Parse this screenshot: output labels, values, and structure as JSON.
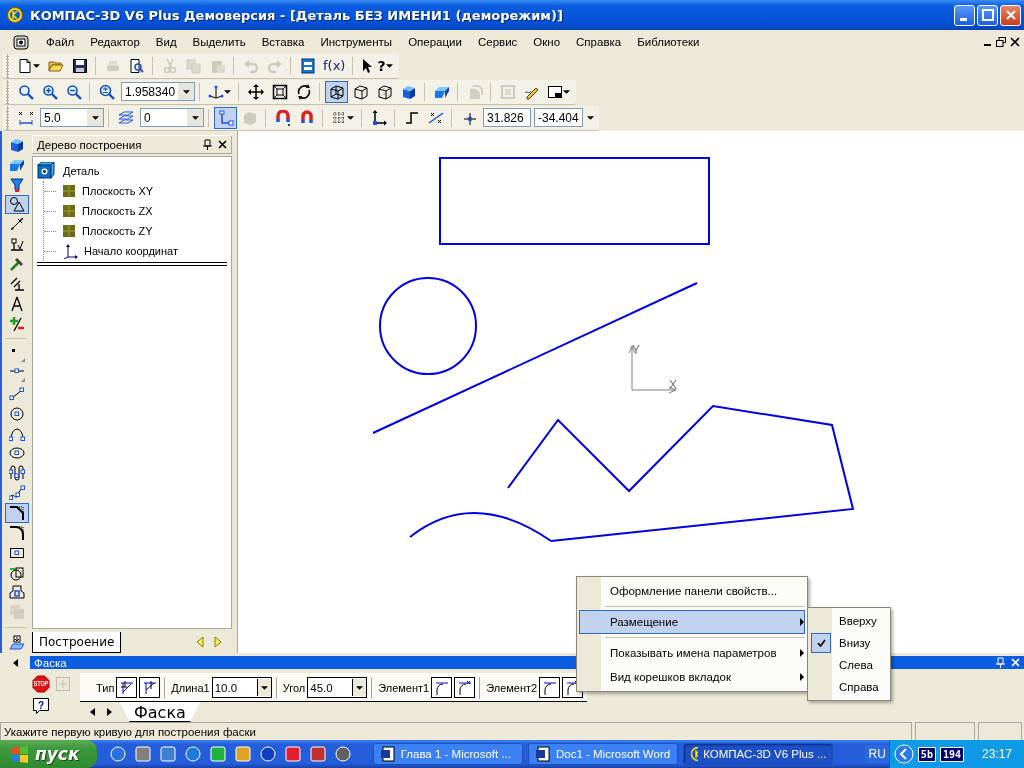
{
  "window": {
    "title": "КОМПАС-3D V6 Plus Демоверсия - [Деталь БЕЗ ИМЕНИ1 (деморежим)]"
  },
  "menu_bar": {
    "items": [
      "Файл",
      "Редактор",
      "Вид",
      "Выделить",
      "Вставка",
      "Инструменты",
      "Операции",
      "Сервис",
      "Окно",
      "Справка",
      "Библиотеки"
    ]
  },
  "toolbars": [
    {
      "items": [
        {
          "kind": "button",
          "selected": false,
          "disabled": false,
          "menu": true
        },
        {
          "kind": "button",
          "selected": false,
          "disabled": false
        },
        {
          "kind": "button",
          "selected": false,
          "disabled": false
        },
        {
          "kind": "separator"
        },
        {
          "kind": "button",
          "selected": false,
          "disabled": true
        },
        {
          "kind": "button",
          "selected": false,
          "disabled": false
        },
        {
          "kind": "separator"
        },
        {
          "kind": "button",
          "selected": false,
          "disabled": true
        },
        {
          "kind": "button",
          "selected": false,
          "disabled": true
        },
        {
          "kind": "button",
          "selected": false,
          "disabled": true
        },
        {
          "kind": "separator"
        },
        {
          "kind": "button",
          "selected": false,
          "disabled": true
        },
        {
          "kind": "button",
          "selected": false,
          "disabled": true
        },
        {
          "kind": "separator"
        },
        {
          "kind": "button",
          "selected": false,
          "disabled": false
        },
        {
          "kind": "button",
          "selected": false,
          "disabled": false,
          "label": "f(x)"
        },
        {
          "kind": "separator"
        },
        {
          "kind": "button",
          "selected": false,
          "disabled": false,
          "label": "?",
          "menu": true
        }
      ]
    },
    {
      "items": [
        {
          "kind": "button",
          "selected": false,
          "disabled": false
        },
        {
          "kind": "button",
          "selected": false,
          "disabled": false
        },
        {
          "kind": "button",
          "selected": false,
          "disabled": false
        },
        {
          "kind": "separator"
        },
        {
          "kind": "button",
          "selected": false,
          "disabled": false
        },
        {
          "kind": "combo",
          "value": "1.958340"
        },
        {
          "kind": "separator"
        },
        {
          "kind": "button",
          "selected": false,
          "disabled": false,
          "menu": true
        },
        {
          "kind": "separator"
        },
        {
          "kind": "button",
          "selected": false,
          "disabled": false
        },
        {
          "kind": "button",
          "selected": false,
          "disabled": false
        },
        {
          "kind": "button",
          "selected": false,
          "disabled": false
        },
        {
          "kind": "separator"
        },
        {
          "kind": "button",
          "selected": true,
          "disabled": false
        },
        {
          "kind": "button",
          "selected": false,
          "disabled": false
        },
        {
          "kind": "button",
          "selected": false,
          "disabled": false
        },
        {
          "kind": "button",
          "selected": false,
          "disabled": false
        },
        {
          "kind": "separator"
        },
        {
          "kind": "button",
          "selected": false,
          "disabled": false
        },
        {
          "kind": "separator"
        },
        {
          "kind": "button",
          "selected": false,
          "disabled": true
        },
        {
          "kind": "separator"
        },
        {
          "kind": "button",
          "selected": false,
          "disabled": true
        },
        {
          "kind": "button",
          "selected": false,
          "disabled": false
        },
        {
          "kind": "button",
          "selected": false,
          "disabled": false,
          "menu": true
        }
      ]
    },
    {
      "items": [
        {
          "kind": "button",
          "selected": false,
          "disabled": false
        },
        {
          "kind": "combo",
          "value": "5.0"
        },
        {
          "kind": "separator"
        },
        {
          "kind": "button",
          "selected": false,
          "disabled": false
        },
        {
          "kind": "combo",
          "value": "0"
        },
        {
          "kind": "separator"
        },
        {
          "kind": "button",
          "selected": true,
          "disabled": false
        },
        {
          "kind": "button",
          "selected": false,
          "disabled": true
        },
        {
          "kind": "separator"
        },
        {
          "kind": "button",
          "selected": false,
          "disabled": false
        },
        {
          "kind": "button",
          "selected": false,
          "disabled": false
        },
        {
          "kind": "separator"
        },
        {
          "kind": "button",
          "selected": false,
          "disabled": false,
          "menu": true
        },
        {
          "kind": "separator"
        },
        {
          "kind": "button",
          "selected": false,
          "disabled": false
        },
        {
          "kind": "separator"
        },
        {
          "kind": "button",
          "selected": false,
          "disabled": false
        },
        {
          "kind": "button",
          "selected": false,
          "disabled": false
        },
        {
          "kind": "separator"
        },
        {
          "kind": "button",
          "selected": false,
          "disabled": false
        },
        {
          "kind": "field",
          "value": "31.826"
        },
        {
          "kind": "field",
          "value": "-34.404"
        },
        {
          "kind": "dropdown"
        }
      ]
    }
  ],
  "left_tools": [
    {
      "kind": "button",
      "selected": false,
      "disabled": false
    },
    {
      "kind": "button",
      "selected": false,
      "disabled": false
    },
    {
      "kind": "button",
      "selected": false,
      "disabled": false
    },
    {
      "kind": "button",
      "selected": true,
      "disabled": false
    },
    {
      "kind": "button",
      "selected": false,
      "disabled": false
    },
    {
      "kind": "button",
      "selected": false,
      "disabled": false
    },
    {
      "kind": "button",
      "selected": false,
      "disabled": false
    },
    {
      "kind": "button",
      "selected": false,
      "disabled": false
    },
    {
      "kind": "button",
      "selected": false,
      "disabled": false
    },
    {
      "kind": "button",
      "selected": false,
      "disabled": false
    },
    {
      "kind": "separator"
    },
    {
      "kind": "button",
      "selected": false,
      "disabled": false
    },
    {
      "kind": "button",
      "selected": false,
      "disabled": false
    },
    {
      "kind": "button",
      "selected": false,
      "disabled": false
    },
    {
      "kind": "button",
      "selected": false,
      "disabled": false
    },
    {
      "kind": "button",
      "selected": false,
      "disabled": false
    },
    {
      "kind": "button",
      "selected": false,
      "disabled": false
    },
    {
      "kind": "button",
      "selected": false,
      "disabled": false
    },
    {
      "kind": "button",
      "selected": false,
      "disabled": false
    },
    {
      "kind": "button",
      "selected": true,
      "disabled": false
    },
    {
      "kind": "button",
      "selected": false,
      "disabled": false
    },
    {
      "kind": "button",
      "selected": false,
      "disabled": false
    },
    {
      "kind": "button",
      "selected": false,
      "disabled": false
    },
    {
      "kind": "button",
      "selected": false,
      "disabled": false
    },
    {
      "kind": "button",
      "selected": false,
      "disabled": true
    },
    {
      "kind": "separator"
    },
    {
      "kind": "button",
      "selected": false,
      "disabled": false
    }
  ],
  "tree": {
    "title": "Дерево построения",
    "root": {
      "label": "Деталь",
      "children": [
        {
          "label": "Плоскость XY",
          "kind": "plane"
        },
        {
          "label": "Плоскость ZX",
          "kind": "plane"
        },
        {
          "label": "Плоскость ZY",
          "kind": "plane"
        },
        {
          "label": "Начало координат",
          "kind": "origin"
        }
      ]
    },
    "tabs": [
      {
        "label": "Построение",
        "selected": true
      }
    ]
  },
  "canvas": {
    "y_label": "Y",
    "x_label": "X"
  },
  "property_panel": {
    "title": "Фаска",
    "stop_label": "STOP",
    "help_label": "?",
    "fields": [
      {
        "kind": "buttons",
        "label": "Тип"
      },
      {
        "kind": "combo",
        "label": "Длина1",
        "value": "10.0"
      },
      {
        "kind": "combo",
        "label": "Угол",
        "value": "45.0"
      },
      {
        "kind": "buttons",
        "label": "Элемент1"
      },
      {
        "kind": "buttons",
        "label": "Элемент2"
      }
    ],
    "tabs": [
      {
        "label": "Фаска",
        "selected": true
      }
    ]
  },
  "status_bar": {
    "text": "Укажите первую кривую для построения фаски"
  },
  "context_menu": {
    "items": [
      {
        "kind": "item",
        "label": "Оформление панели свойств...",
        "submenu": false,
        "selected": false
      },
      {
        "kind": "separator"
      },
      {
        "kind": "item",
        "label": "Размещение",
        "submenu": true,
        "selected": true
      },
      {
        "kind": "separator"
      },
      {
        "kind": "item",
        "label": "Показывать имена параметров",
        "submenu": true,
        "selected": false
      },
      {
        "kind": "item",
        "label": "Вид корешков вкладок",
        "submenu": true,
        "selected": false
      }
    ],
    "submenu": [
      {
        "label": "Вверху",
        "checked": false
      },
      {
        "label": "Внизу",
        "checked": true
      },
      {
        "label": "Слева",
        "checked": false
      },
      {
        "label": "Справа",
        "checked": false
      }
    ]
  },
  "taskbar": {
    "start": "пуск",
    "tasks": [
      {
        "label": "Глава 1 - Microsoft ...",
        "selected": false
      },
      {
        "label": "Doc1 - Microsoft Word",
        "selected": false
      },
      {
        "label": "КОМПАС-3D V6 Plus ...",
        "selected": true
      }
    ],
    "language": "RU",
    "tray": [
      "5b",
      "194"
    ],
    "clock": "23:17"
  }
}
